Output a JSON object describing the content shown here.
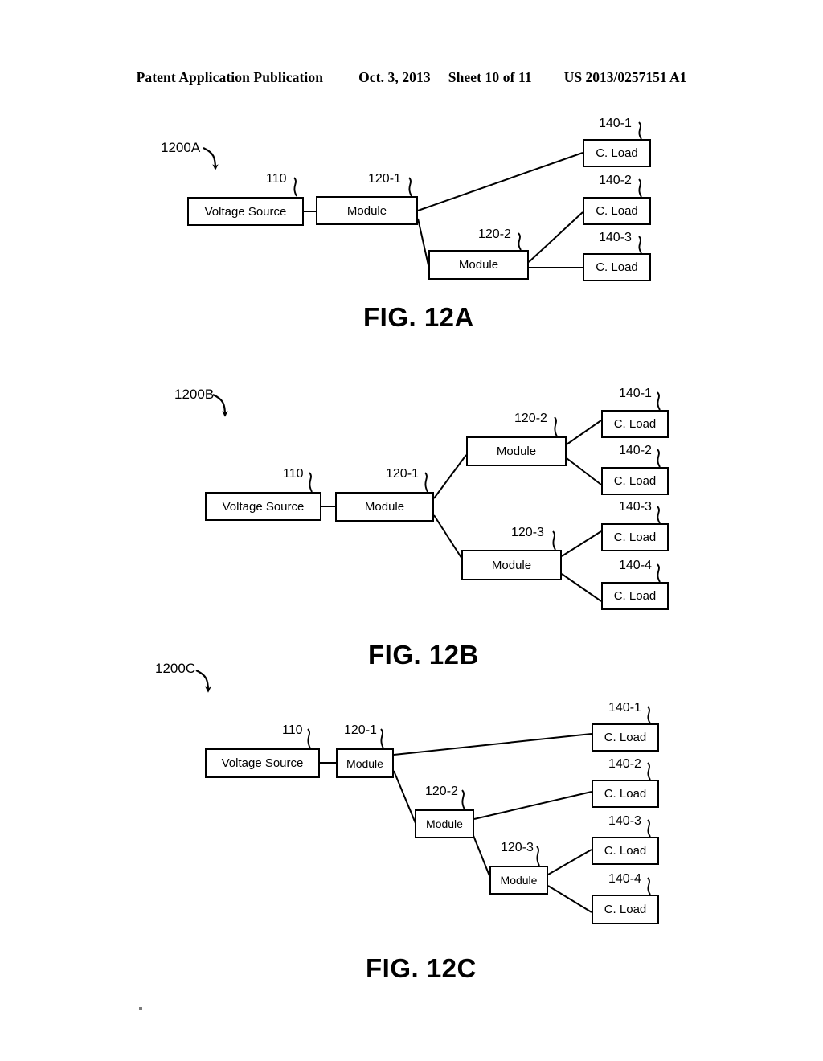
{
  "header": {
    "publication": "Patent Application Publication",
    "date": "Oct. 3, 2013",
    "sheet": "Sheet 10 of 11",
    "patent_number": "US 2013/0257151 A1"
  },
  "labels": {
    "voltage_source": "Voltage Source",
    "module": "Module",
    "c_load": "C. Load"
  },
  "refs": {
    "voltage_source": "110",
    "module_1": "120-1",
    "module_2": "120-2",
    "module_3": "120-3",
    "load_1": "140-1",
    "load_2": "140-2",
    "load_3": "140-3",
    "load_4": "140-4"
  },
  "figures": [
    {
      "id": "fig12a",
      "caption": "FIG. 12A",
      "system_label": "1200A",
      "description": "Voltage source feeds Module 120-1; Module 120-1 feeds C. Load 140-1 and Module 120-2; Module 120-2 feeds C. Load 140-2 and C. Load 140-3.",
      "nodes": [
        {
          "name": "voltage-source",
          "label": "Voltage Source",
          "ref": "110"
        },
        {
          "name": "module-120-1",
          "label": "Module",
          "ref": "120-1"
        },
        {
          "name": "module-120-2",
          "label": "Module",
          "ref": "120-2"
        },
        {
          "name": "c-load-140-1",
          "label": "C. Load",
          "ref": "140-1"
        },
        {
          "name": "c-load-140-2",
          "label": "C. Load",
          "ref": "140-2"
        },
        {
          "name": "c-load-140-3",
          "label": "C. Load",
          "ref": "140-3"
        }
      ]
    },
    {
      "id": "fig12b",
      "caption": "FIG. 12B",
      "system_label": "1200B",
      "description": "Voltage source feeds Module 120-1; Module 120-1 branches to Module 120-2 and Module 120-3; Module 120-2 feeds C. Load 140-1 and 140-2; Module 120-3 feeds C. Load 140-3 and 140-4.",
      "nodes": [
        {
          "name": "voltage-source",
          "label": "Voltage Source",
          "ref": "110"
        },
        {
          "name": "module-120-1",
          "label": "Module",
          "ref": "120-1"
        },
        {
          "name": "module-120-2",
          "label": "Module",
          "ref": "120-2"
        },
        {
          "name": "module-120-3",
          "label": "Module",
          "ref": "120-3"
        },
        {
          "name": "c-load-140-1",
          "label": "C. Load",
          "ref": "140-1"
        },
        {
          "name": "c-load-140-2",
          "label": "C. Load",
          "ref": "140-2"
        },
        {
          "name": "c-load-140-3",
          "label": "C. Load",
          "ref": "140-3"
        },
        {
          "name": "c-load-140-4",
          "label": "C. Load",
          "ref": "140-4"
        }
      ]
    },
    {
      "id": "fig12c",
      "caption": "FIG. 12C",
      "system_label": "1200C",
      "description": "Voltage source feeds Module 120-1; Module 120-1 feeds C. Load 140-1 and Module 120-2; Module 120-2 feeds C. Load 140-2 and Module 120-3; Module 120-3 feeds C. Load 140-3 and C. Load 140-4.",
      "nodes": [
        {
          "name": "voltage-source",
          "label": "Voltage Source",
          "ref": "110"
        },
        {
          "name": "module-120-1",
          "label": "Module",
          "ref": "120-1"
        },
        {
          "name": "module-120-2",
          "label": "Module",
          "ref": "120-2"
        },
        {
          "name": "module-120-3",
          "label": "Module",
          "ref": "120-3"
        },
        {
          "name": "c-load-140-1",
          "label": "C. Load",
          "ref": "140-1"
        },
        {
          "name": "c-load-140-2",
          "label": "C. Load",
          "ref": "140-2"
        },
        {
          "name": "c-load-140-3",
          "label": "C. Load",
          "ref": "140-3"
        },
        {
          "name": "c-load-140-4",
          "label": "C. Load",
          "ref": "140-4"
        }
      ]
    }
  ]
}
